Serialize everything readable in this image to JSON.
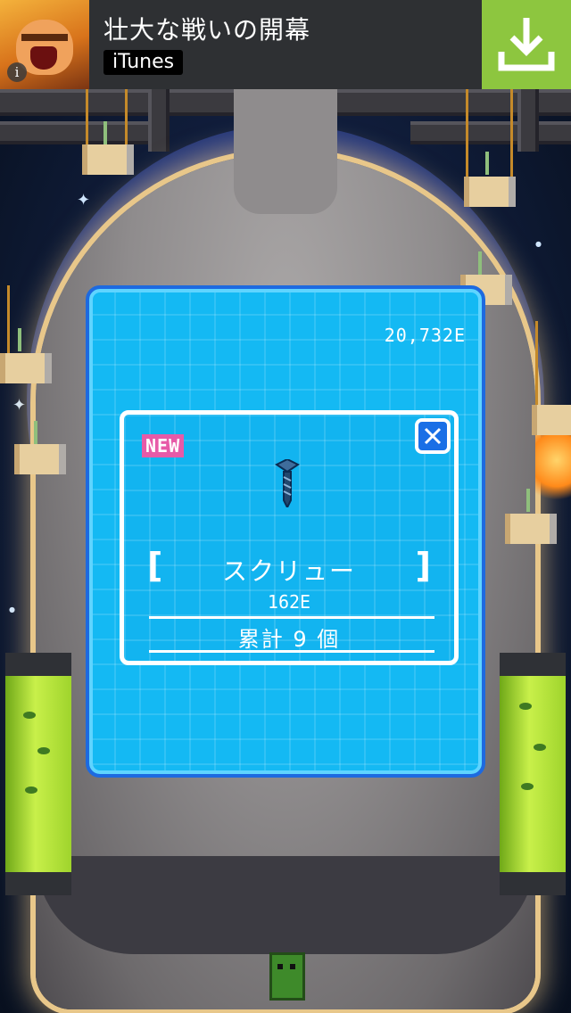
{
  "ad": {
    "title": "壮大な戦いの開幕",
    "store_badge": "iTunes",
    "info_glyph": "i",
    "icon_name": "download-icon"
  },
  "game": {
    "energy_total": "20,732E",
    "item_popup": {
      "new_label": "NEW",
      "item_name": "スクリュー",
      "item_value": "162E",
      "total_label": "累計 9 個",
      "close_icon": "close-icon",
      "left_bracket": "[",
      "right_bracket": "]"
    }
  },
  "colors": {
    "panel_blue": "#14b9f3",
    "panel_border": "#1d6ae0",
    "new_badge": "#e75aa8",
    "download_green": "#8dc63f"
  }
}
